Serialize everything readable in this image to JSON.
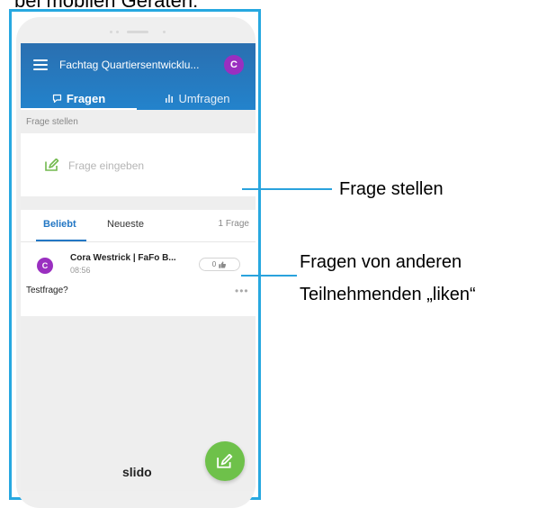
{
  "caption_top": "bei mobilen Geräten:",
  "header": {
    "event_title": "Fachtag Quartiersentwicklu...",
    "avatar_letter": "C"
  },
  "tabs": [
    {
      "label": "Fragen",
      "active": true
    },
    {
      "label": "Umfragen",
      "active": false
    }
  ],
  "ask": {
    "section_label": "Frage stellen",
    "placeholder": "Frage eingeben"
  },
  "list": {
    "sort_popular": "Beliebt",
    "sort_newest": "Neueste",
    "count": "1 Frage",
    "questions": [
      {
        "avatar_letter": "C",
        "author": "Cora Westrick | FaFo B...",
        "time": "08:56",
        "likes": "0",
        "text": "Testfrage?"
      }
    ]
  },
  "brand": "slido",
  "annotations": {
    "ask_label": "Frage stellen",
    "like_label_line1": "Fragen von anderen",
    "like_label_line2": "Teilnehmenden „liken“"
  },
  "colors": {
    "header_blue": "#2383cc",
    "accent_purple": "#9a2fc0",
    "fab_green": "#6ec14a",
    "callout_blue": "#2aa2dd"
  }
}
